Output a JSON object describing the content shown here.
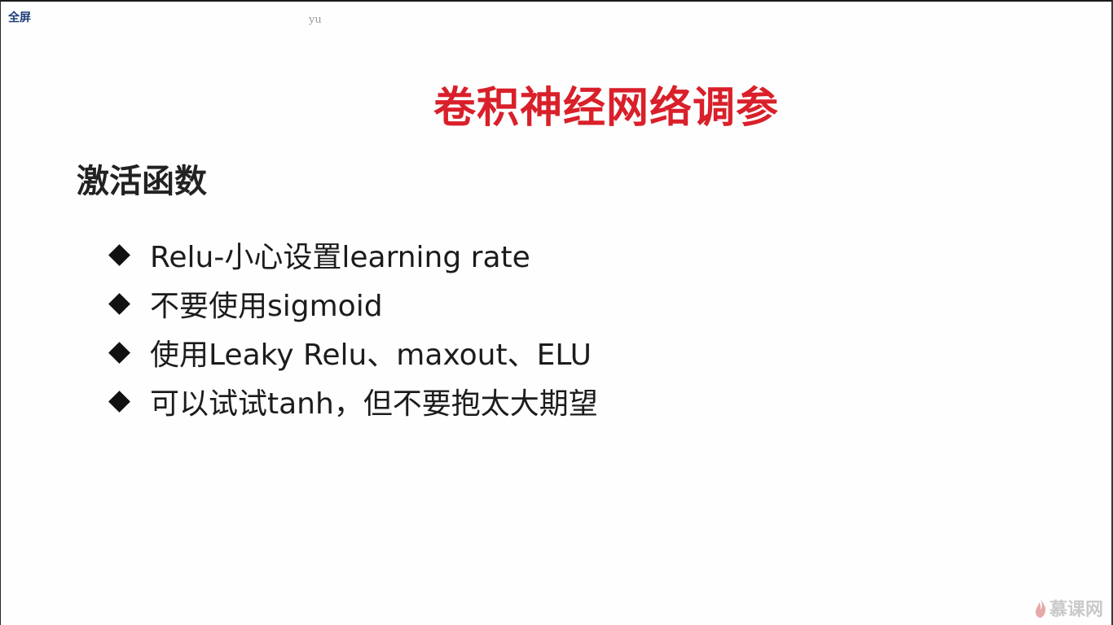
{
  "toolbar": {
    "fullscreen_label": "全屏"
  },
  "watermark": {
    "user": "yu"
  },
  "slide": {
    "title": "卷积神经网络调参",
    "section_heading": "激活函数",
    "bullets": [
      "Relu-小心设置learning rate",
      "不要使用sigmoid",
      "使用Leaky Relu、maxout、ELU",
      "可以试试tanh，但不要抱太大期望"
    ]
  },
  "logo": {
    "text": "慕课网",
    "icon": "flame-icon"
  },
  "colors": {
    "title": "#d9202a",
    "text": "#1c1c1c",
    "fullscreen": "#1d3c7a",
    "logo": "#c9c9c9"
  }
}
